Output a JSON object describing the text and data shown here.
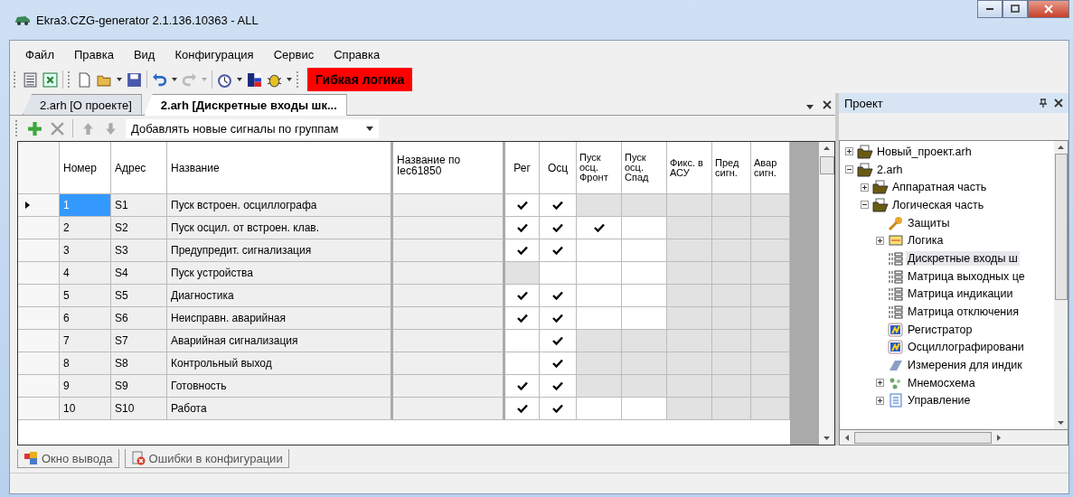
{
  "window": {
    "title": "Ekra3.CZG-generator 2.1.136.10363 - ALL"
  },
  "menu": [
    "Файл",
    "Правка",
    "Вид",
    "Конфигурация",
    "Сервис",
    "Справка"
  ],
  "toolbar": {
    "mode_label": "Гибкая логика"
  },
  "doc_tabs": [
    {
      "label": "2.arh [О проекте]",
      "selected": false
    },
    {
      "label": "2.arh [Дискретные входы шк...",
      "selected": true
    }
  ],
  "signal_toolbar": {
    "group_mode": "Добавлять новые сигналы по группам"
  },
  "table": {
    "columns": [
      "Номер",
      "Адрес",
      "Название",
      "Название по Iec61850",
      "Рег",
      "Осц",
      "Пуск осц. Фронт",
      "Пуск осц. Спад",
      "Фикс. в АСУ",
      "Пред сигн.",
      "Авар сигн."
    ],
    "rows": [
      {
        "number": "1",
        "address": "S1",
        "name": "Пуск встроен. осциллографа",
        "current": true,
        "flags": [
          {
            "checked": true,
            "disabled": false
          },
          {
            "checked": true,
            "disabled": false
          },
          {
            "checked": false,
            "disabled": true
          },
          {
            "checked": false,
            "disabled": true
          },
          {
            "checked": false,
            "disabled": true
          },
          {
            "checked": false,
            "disabled": true
          },
          {
            "checked": false,
            "disabled": true
          }
        ]
      },
      {
        "number": "2",
        "address": "S2",
        "name": "Пуск осцил. от встроен. клав.",
        "current": false,
        "flags": [
          {
            "checked": true,
            "disabled": false
          },
          {
            "checked": true,
            "disabled": false
          },
          {
            "checked": true,
            "disabled": false
          },
          {
            "checked": false,
            "disabled": false
          },
          {
            "checked": false,
            "disabled": true
          },
          {
            "checked": false,
            "disabled": true
          },
          {
            "checked": false,
            "disabled": true
          }
        ]
      },
      {
        "number": "3",
        "address": "S3",
        "name": "Предупредит. сигнализация",
        "current": false,
        "flags": [
          {
            "checked": true,
            "disabled": false
          },
          {
            "checked": true,
            "disabled": false
          },
          {
            "checked": false,
            "disabled": false
          },
          {
            "checked": false,
            "disabled": false
          },
          {
            "checked": false,
            "disabled": true
          },
          {
            "checked": false,
            "disabled": true
          },
          {
            "checked": false,
            "disabled": true
          }
        ]
      },
      {
        "number": "4",
        "address": "S4",
        "name": "Пуск устройства",
        "current": false,
        "flags": [
          {
            "checked": false,
            "disabled": true
          },
          {
            "checked": false,
            "disabled": false
          },
          {
            "checked": false,
            "disabled": false
          },
          {
            "checked": false,
            "disabled": false
          },
          {
            "checked": false,
            "disabled": true
          },
          {
            "checked": false,
            "disabled": true
          },
          {
            "checked": false,
            "disabled": true
          }
        ]
      },
      {
        "number": "5",
        "address": "S5",
        "name": "Диагностика",
        "current": false,
        "flags": [
          {
            "checked": true,
            "disabled": false
          },
          {
            "checked": true,
            "disabled": false
          },
          {
            "checked": false,
            "disabled": false
          },
          {
            "checked": false,
            "disabled": false
          },
          {
            "checked": false,
            "disabled": true
          },
          {
            "checked": false,
            "disabled": true
          },
          {
            "checked": false,
            "disabled": true
          }
        ]
      },
      {
        "number": "6",
        "address": "S6",
        "name": "Неисправн. аварийная",
        "current": false,
        "flags": [
          {
            "checked": true,
            "disabled": false
          },
          {
            "checked": true,
            "disabled": false
          },
          {
            "checked": false,
            "disabled": false
          },
          {
            "checked": false,
            "disabled": false
          },
          {
            "checked": false,
            "disabled": true
          },
          {
            "checked": false,
            "disabled": true
          },
          {
            "checked": false,
            "disabled": true
          }
        ]
      },
      {
        "number": "7",
        "address": "S7",
        "name": "Аварийная сигнализация",
        "current": false,
        "flags": [
          {
            "checked": false,
            "disabled": false
          },
          {
            "checked": true,
            "disabled": false
          },
          {
            "checked": false,
            "disabled": true
          },
          {
            "checked": false,
            "disabled": true
          },
          {
            "checked": false,
            "disabled": true
          },
          {
            "checked": false,
            "disabled": true
          },
          {
            "checked": false,
            "disabled": true
          }
        ]
      },
      {
        "number": "8",
        "address": "S8",
        "name": "Контрольный выход",
        "current": false,
        "flags": [
          {
            "checked": false,
            "disabled": false
          },
          {
            "checked": true,
            "disabled": false
          },
          {
            "checked": false,
            "disabled": true
          },
          {
            "checked": false,
            "disabled": true
          },
          {
            "checked": false,
            "disabled": true
          },
          {
            "checked": false,
            "disabled": true
          },
          {
            "checked": false,
            "disabled": true
          }
        ]
      },
      {
        "number": "9",
        "address": "S9",
        "name": "Готовность",
        "current": false,
        "flags": [
          {
            "checked": true,
            "disabled": false
          },
          {
            "checked": true,
            "disabled": false
          },
          {
            "checked": false,
            "disabled": true
          },
          {
            "checked": false,
            "disabled": true
          },
          {
            "checked": false,
            "disabled": true
          },
          {
            "checked": false,
            "disabled": true
          },
          {
            "checked": false,
            "disabled": true
          }
        ]
      },
      {
        "number": "10",
        "address": "S10",
        "name": "Работа",
        "current": false,
        "flags": [
          {
            "checked": true,
            "disabled": false
          },
          {
            "checked": true,
            "disabled": false
          },
          {
            "checked": false,
            "disabled": false
          },
          {
            "checked": false,
            "disabled": false
          },
          {
            "checked": false,
            "disabled": true
          },
          {
            "checked": false,
            "disabled": true
          },
          {
            "checked": false,
            "disabled": true
          }
        ]
      }
    ]
  },
  "project_panel": {
    "title": "Проект",
    "tree": [
      {
        "label": "Новый_проект.arh",
        "kind": "folder",
        "expanded": false,
        "selected": false
      },
      {
        "label": "2.arh",
        "kind": "folder",
        "expanded": true,
        "selected": false,
        "children": [
          {
            "label": "Аппаратная часть",
            "kind": "folder",
            "expanded": false,
            "selected": false
          },
          {
            "label": "Логическая часть",
            "kind": "folder",
            "expanded": true,
            "selected": false,
            "children": [
              {
                "label": "Защиты",
                "kind": "key",
                "selected": false
              },
              {
                "label": "Логика",
                "kind": "logic",
                "expanded": false,
                "selected": false
              },
              {
                "label": "Дискретные входы ш",
                "kind": "matrix",
                "selected": true
              },
              {
                "label": "Матрица выходных це",
                "kind": "matrix",
                "selected": false
              },
              {
                "label": "Матрица индикации",
                "kind": "matrix",
                "selected": false
              },
              {
                "label": "Матрица отключения",
                "kind": "matrix",
                "selected": false
              },
              {
                "label": "Регистратор",
                "kind": "recorder",
                "selected": false
              },
              {
                "label": "Осциллографировани",
                "kind": "recorder",
                "selected": false
              },
              {
                "label": "Измерения для индик",
                "kind": "measure",
                "selected": false
              },
              {
                "label": "Мнемосхема",
                "kind": "scheme",
                "expanded": false,
                "selected": false
              },
              {
                "label": "Управление",
                "kind": "doc",
                "expanded": false,
                "selected": false
              }
            ]
          }
        ]
      }
    ]
  },
  "bottom_tabs": [
    {
      "label": "Окно вывода",
      "kind": "output"
    },
    {
      "label": "Ошибки в конфигурации",
      "kind": "errors"
    }
  ]
}
